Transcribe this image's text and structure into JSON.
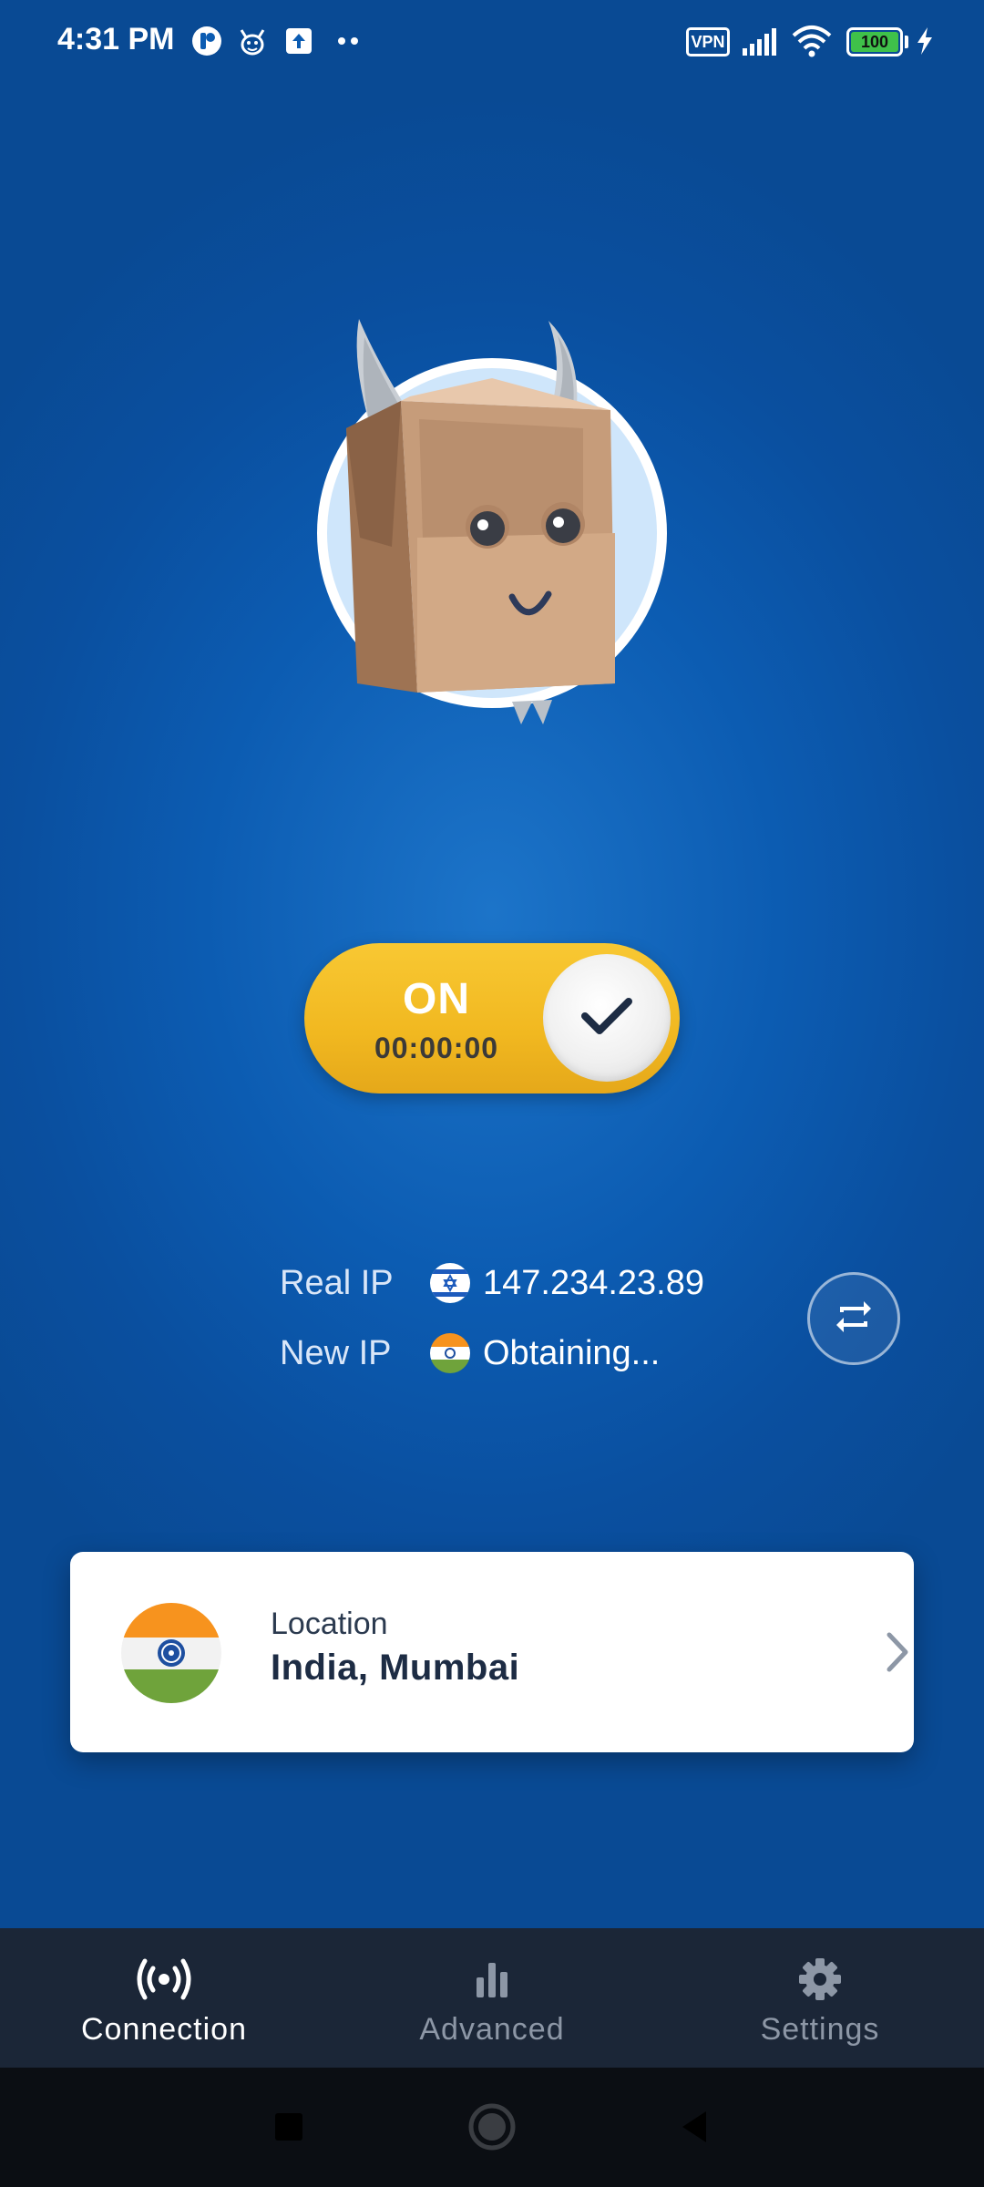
{
  "status_bar": {
    "time": "4:31 PM",
    "vpn_badge": "VPN",
    "battery_level": "100",
    "icons": [
      "app-circle-icon",
      "cat-face-icon",
      "upload-arrow-icon",
      "more-dots-icon",
      "signal-icon",
      "wifi-icon",
      "battery-icon",
      "charging-bolt-icon"
    ]
  },
  "mascot": {
    "icon": "paper-bag-cow-mascot"
  },
  "toggle": {
    "state_label": "ON",
    "timer": "00:00:00",
    "knob_icon": "checkmark-icon",
    "colors": {
      "track": "#f1b820",
      "knob": "#f0f0f0"
    }
  },
  "ip_info": {
    "real_ip_label": "Real IP",
    "real_ip_value": "147.234.23.89",
    "real_ip_flag": "israel-flag-icon",
    "new_ip_label": "New IP",
    "new_ip_value": "Obtaining...",
    "new_ip_flag": "india-flag-icon",
    "refresh_icon": "repeat-icon"
  },
  "location": {
    "caption": "Location",
    "value": "India, Mumbai",
    "flag_icon": "india-flag-icon",
    "chevron_icon": "chevron-right-icon"
  },
  "bottom_nav": {
    "items": [
      {
        "label": "Connection",
        "icon": "broadcast-icon",
        "active": true
      },
      {
        "label": "Advanced",
        "icon": "bar-chart-icon",
        "active": false
      },
      {
        "label": "Settings",
        "icon": "gear-icon",
        "active": false
      }
    ]
  },
  "system_nav": {
    "icons": [
      "recents-square-icon",
      "home-circle-icon",
      "back-triangle-icon"
    ]
  },
  "colors": {
    "background": "#0c5cb2",
    "accent_yellow": "#f1b820",
    "card": "#ffffff",
    "nav_bar": "#1b2637"
  }
}
